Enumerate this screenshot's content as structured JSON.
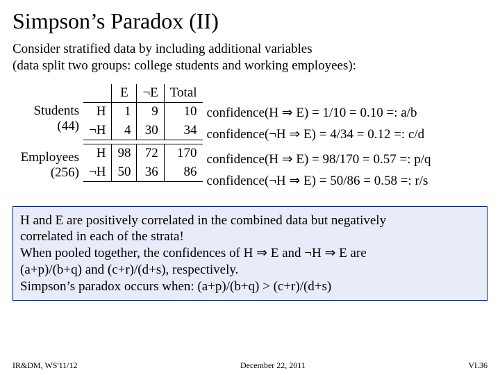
{
  "title": "Simpson’s Paradox (II)",
  "intro_l1": "Consider stratified data by including additional variables",
  "intro_l2": "(data split two groups: college students and working employees):",
  "headers": {
    "col_e": "E",
    "col_not_e": "¬E",
    "col_total": "Total",
    "row_h": "H",
    "row_not_h": "¬H"
  },
  "group_a": {
    "label_l1": "Students",
    "label_l2": "(44)",
    "r1": {
      "e": "1",
      "ne": "9",
      "tot": "10"
    },
    "r2": {
      "e": "4",
      "ne": "30",
      "tot": "34"
    }
  },
  "group_b": {
    "label_l1": "Employees",
    "label_l2": "(256)",
    "r1": {
      "e": "98",
      "ne": "72",
      "tot": "170"
    },
    "r2": {
      "e": "50",
      "ne": "36",
      "tot": "86"
    }
  },
  "conf": {
    "l1": "confidence(H ⇒ E)   = 1/10 = 0.10   =: a/b",
    "l2": "confidence(¬H ⇒ E) = 4/34 = 0.12   =: c/d",
    "l3": "confidence(H ⇒ E)   = 98/170 = 0.57 =: p/q",
    "l4": "confidence(¬H ⇒ E) = 50/86  = 0.58  =: r/s"
  },
  "note": {
    "l1": "H and E are positively correlated in the combined data but negatively",
    "l2": "correlated in each of the strata!",
    "l3": "When pooled together, the confidences of H ⇒ E and ¬H ⇒ E are",
    "l4": "(a+p)/(b+q) and (c+r)/(d+s), respectively.",
    "l5": "Simpson’s paradox occurs when: (a+p)/(b+q) > (c+r)/(d+s)"
  },
  "footer": {
    "left": "IR&DM, WS'11/12",
    "center": "December 22, 2011",
    "right": "VI.36"
  },
  "chart_data": {
    "type": "table",
    "title": "Simpson's Paradox stratified 2x2 tables",
    "strata": [
      {
        "name": "Students",
        "n": 44,
        "cells": {
          "H_E": 1,
          "H_notE": 9,
          "notH_E": 4,
          "notH_notE": 30
        },
        "row_totals": {
          "H": 10,
          "notH": 34
        },
        "confidence_H_implies_E": 0.1,
        "confidence_notH_implies_E": 0.12
      },
      {
        "name": "Employees",
        "n": 256,
        "cells": {
          "H_E": 98,
          "H_notE": 72,
          "notH_E": 50,
          "notH_notE": 36
        },
        "row_totals": {
          "H": 170,
          "notH": 86
        },
        "confidence_H_implies_E": 0.57,
        "confidence_notH_implies_E": 0.58
      }
    ]
  }
}
